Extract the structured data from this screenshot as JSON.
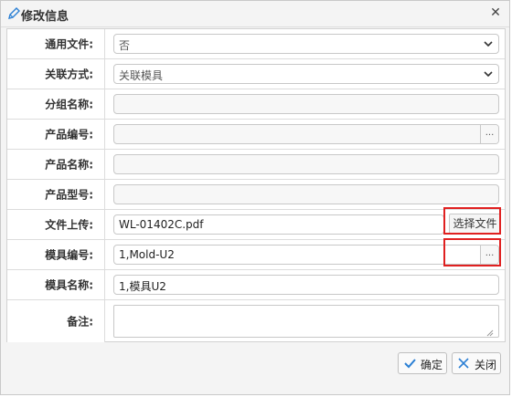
{
  "dialog": {
    "title": "修改信息",
    "close_symbol": "✕"
  },
  "form": {
    "rows": [
      {
        "label": "通用文件:",
        "value": "否",
        "type": "select"
      },
      {
        "label": "关联方式:",
        "value": "关联模具",
        "type": "select"
      },
      {
        "label": "分组名称:",
        "value": "",
        "type": "input"
      },
      {
        "label": "产品编号:",
        "value": "",
        "type": "lookup"
      },
      {
        "label": "产品名称:",
        "value": "",
        "type": "input"
      },
      {
        "label": "产品型号:",
        "value": "",
        "type": "input"
      },
      {
        "label": "文件上传:",
        "value": "WL-01402C.pdf",
        "type": "file"
      },
      {
        "label": "模具编号:",
        "value": "1,Mold-U2",
        "type": "lookup"
      },
      {
        "label": "模具名称:",
        "value": "1,模具U2",
        "type": "input"
      },
      {
        "label": "备注:",
        "value": "",
        "type": "textarea"
      }
    ],
    "file_button_label": "选择文件",
    "lookup_button_label": "..."
  },
  "footer": {
    "confirm_label": "确定",
    "close_label": "关闭"
  },
  "colors": {
    "highlight": "#e02020",
    "confirm_icon": "#2a7fd4",
    "close_icon": "#2a7fd4"
  }
}
